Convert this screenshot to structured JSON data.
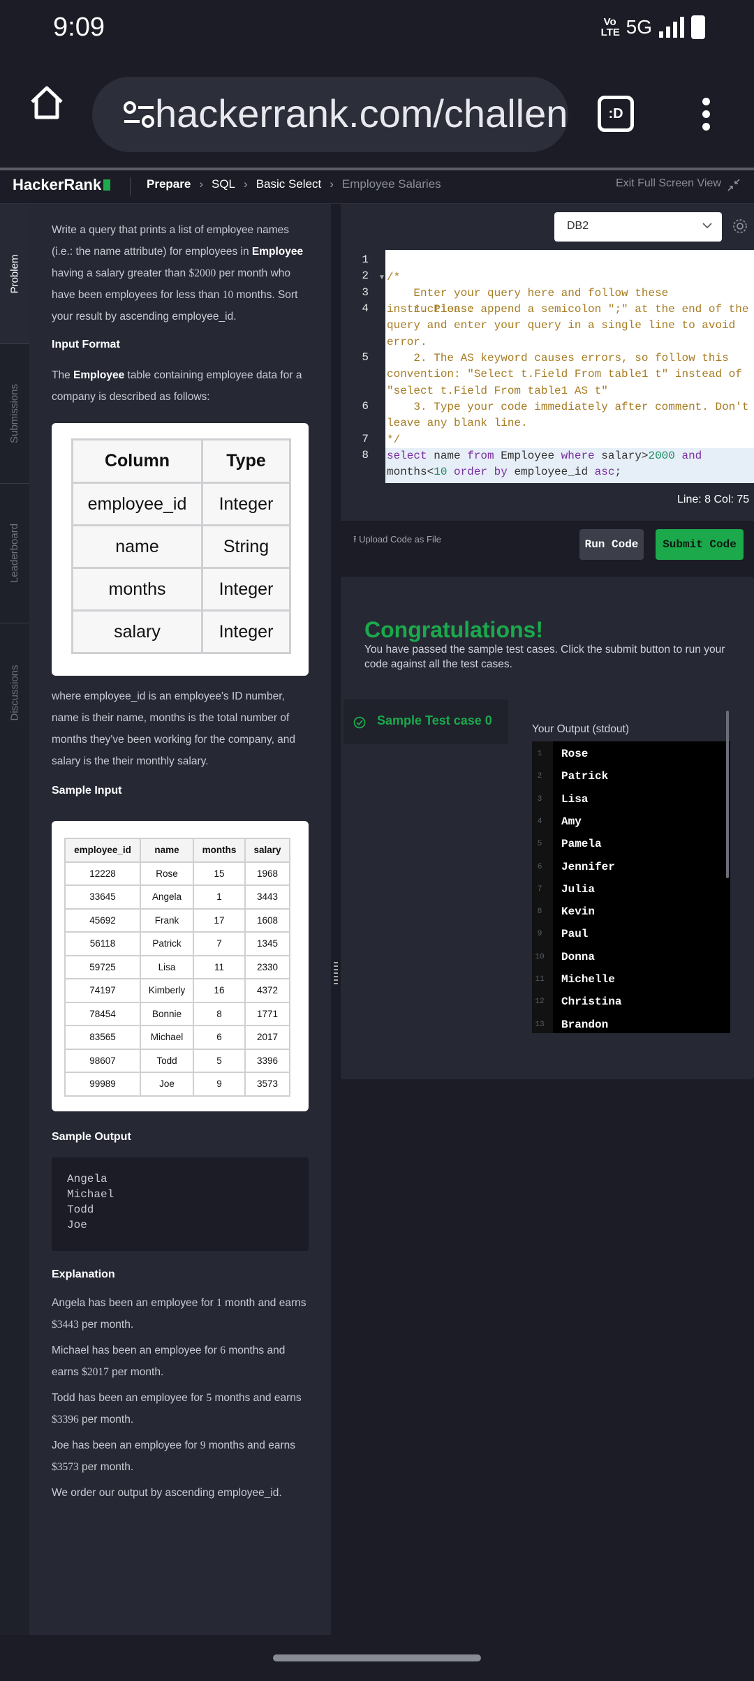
{
  "status": {
    "time": "9:09",
    "volte": "Vo LTE",
    "network": "5G"
  },
  "browser": {
    "url": "hackerrank.com/challenges/s",
    "tab_icon_text": ":D"
  },
  "header": {
    "logo": "HackerRank",
    "breadcrumbs": [
      "Prepare",
      "SQL",
      "Basic Select",
      "Employee Salaries"
    ],
    "exit_fullscreen": "Exit Full Screen View"
  },
  "vtabs": [
    "Problem",
    "Submissions",
    "Leaderboard",
    "Discussions"
  ],
  "problem": {
    "intro_1": "Write a query that prints a list of employee names (i.e.: the name attribute) for employees in ",
    "intro_table": "Employee",
    "intro_2": " having a salary greater than ",
    "intro_salary": "$2000",
    "intro_3": " per month who have been employees for less than ",
    "intro_months": "10",
    "intro_4": " months. Sort your result by ascending employee_id.",
    "input_format_title": "Input Format",
    "input_format_1": "The ",
    "input_format_table": "Employee",
    "input_format_2": " table containing employee data for a company is described as follows:",
    "columns_header": [
      "Column",
      "Type"
    ],
    "columns": [
      [
        "employee_id",
        "Integer"
      ],
      [
        "name",
        "String"
      ],
      [
        "months",
        "Integer"
      ],
      [
        "salary",
        "Integer"
      ]
    ],
    "description": "where employee_id is an employee's ID number, name is their name, months is the total number of months they've been working for the company, and salary is the their monthly salary.",
    "sample_input_title": "Sample Input",
    "sample_header": [
      "employee_id",
      "name",
      "months",
      "salary"
    ],
    "sample_rows": [
      [
        "12228",
        "Rose",
        "15",
        "1968"
      ],
      [
        "33645",
        "Angela",
        "1",
        "3443"
      ],
      [
        "45692",
        "Frank",
        "17",
        "1608"
      ],
      [
        "56118",
        "Patrick",
        "7",
        "1345"
      ],
      [
        "59725",
        "Lisa",
        "11",
        "2330"
      ],
      [
        "74197",
        "Kimberly",
        "16",
        "4372"
      ],
      [
        "78454",
        "Bonnie",
        "8",
        "1771"
      ],
      [
        "83565",
        "Michael",
        "6",
        "2017"
      ],
      [
        "98607",
        "Todd",
        "5",
        "3396"
      ],
      [
        "99989",
        "Joe",
        "9",
        "3573"
      ]
    ],
    "sample_output_title": "Sample Output",
    "sample_output": [
      "Angela",
      "Michael",
      "Todd",
      "Joe"
    ],
    "explanation_title": "Explanation",
    "explanations": [
      {
        "pre": "Angela has been an employee for ",
        "m": "1",
        "mid": " month and earns ",
        "s": "$3443",
        "post": " per month."
      },
      {
        "pre": "Michael has been an employee for ",
        "m": "6",
        "mid": " months and earns ",
        "s": "$2017",
        "post": " per month."
      },
      {
        "pre": "Todd has been an employee for ",
        "m": "5",
        "mid": " months and earns ",
        "s": "$3396",
        "post": " per month."
      },
      {
        "pre": "Joe has been an employee for ",
        "m": "9",
        "mid": " months and earns ",
        "s": "$3573",
        "post": " per month."
      }
    ],
    "order_note": "We order our output by ascending employee_id."
  },
  "editor": {
    "language": "DB2",
    "line_numbers": [
      "1",
      "2",
      "3",
      "4",
      "5",
      "6",
      "7",
      "8"
    ],
    "comment_lines": [
      "/*",
      "    Enter your query here and follow these instructions:",
      "    1. Please append a semicolon \";\" at the end of the query and enter your query in a single line to avoid error.",
      "    2. The AS keyword causes errors, so follow this convention: \"Select t.Field From table1 t\" instead of \"select t.Field From table1 AS t\"",
      "    3. Type your code immediately after comment. Don't leave any blank line.",
      "*/"
    ],
    "query_tokens": {
      "select": "select",
      "name": " name ",
      "from": "from",
      "table": " Employee ",
      "where": "where",
      "cond1": " salary>",
      "n2000": "2000",
      "and": " and",
      "cond2": "months<",
      "n10": "10",
      "order": " order",
      "by": " by",
      "col": " employee_id ",
      "asc": "asc",
      "end": ";"
    },
    "position": "Line: 8 Col: 75",
    "upload": "Upload Code as File",
    "run": "Run Code",
    "submit": "Submit Code"
  },
  "results": {
    "title": "Congratulations!",
    "subtitle": "You have passed the sample test cases. Click the submit button to run your code against all the test cases.",
    "test_case": "Sample Test case 0",
    "output_label": "Your Output (stdout)",
    "output": [
      {
        "n": "1",
        "v": "Rose"
      },
      {
        "n": "2",
        "v": "Patrick"
      },
      {
        "n": "3",
        "v": "Lisa"
      },
      {
        "n": "4",
        "v": "Amy"
      },
      {
        "n": "5",
        "v": "Pamela"
      },
      {
        "n": "6",
        "v": "Jennifer"
      },
      {
        "n": "7",
        "v": "Julia"
      },
      {
        "n": "8",
        "v": "Kevin"
      },
      {
        "n": "9",
        "v": "Paul"
      },
      {
        "n": "10",
        "v": "Donna"
      },
      {
        "n": "11",
        "v": "Michelle"
      },
      {
        "n": "12",
        "v": "Christina"
      },
      {
        "n": "13",
        "v": "Brandon"
      }
    ]
  },
  "colors": {
    "accent_green": "#1ba94c",
    "code_comment": "#a67c22",
    "code_keyword": "#7a2fa0"
  }
}
